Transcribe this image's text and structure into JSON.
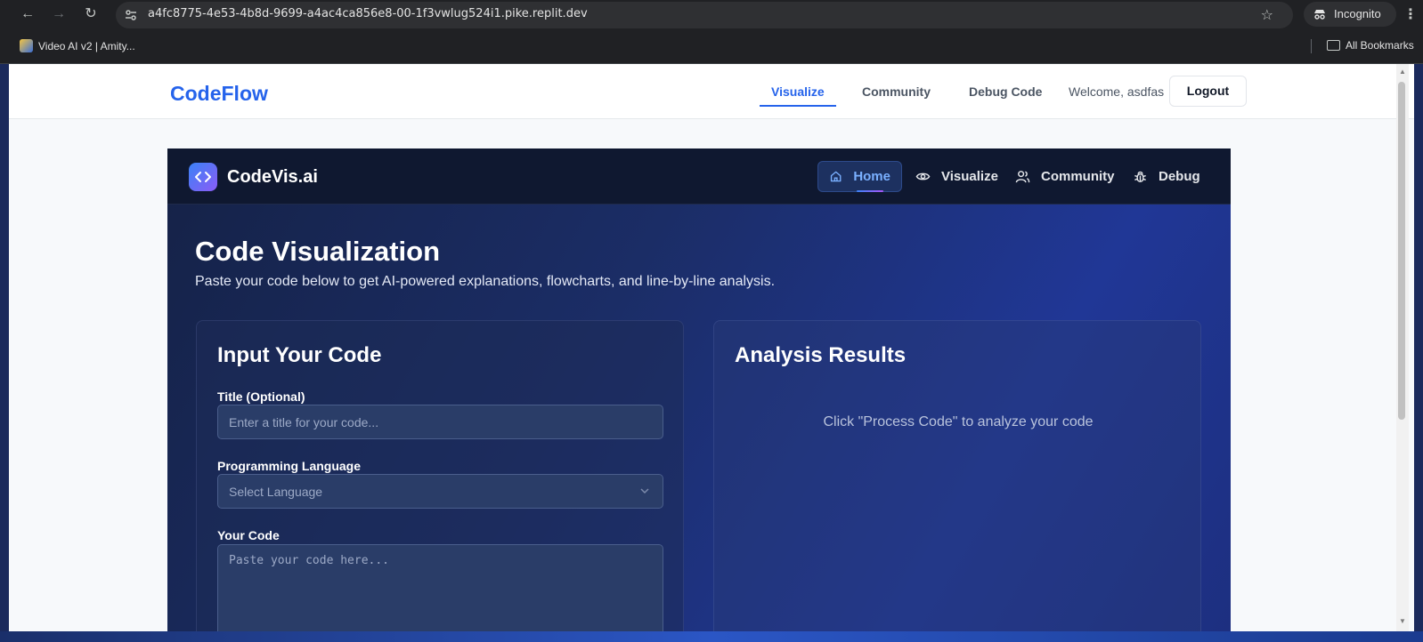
{
  "browser": {
    "url": "a4fc8775-4e53-4b8d-9699-a4ac4ca856e8-00-1f3vwlug524i1.pike.replit.dev",
    "incognito_label": "Incognito",
    "bookmark": "Video AI v2 | Amity...",
    "all_bookmarks": "All Bookmarks"
  },
  "site_header": {
    "logo": "CodeFlow",
    "nav": [
      "Visualize",
      "Community",
      "Debug Code"
    ],
    "active_nav": "Visualize",
    "welcome": "Welcome, asdfas",
    "logout": "Logout"
  },
  "app": {
    "brand": "CodeVis.ai",
    "nav": [
      {
        "label": "Home",
        "icon": "home-icon"
      },
      {
        "label": "Visualize",
        "icon": "eye-icon"
      },
      {
        "label": "Community",
        "icon": "users-icon"
      },
      {
        "label": "Debug",
        "icon": "bug-icon"
      }
    ],
    "title": "Code Visualization",
    "subtitle": "Paste your code below to get AI-powered explanations, flowcharts, and line-by-line analysis.",
    "input_card": {
      "title": "Input Your Code",
      "title_label": "Title (Optional)",
      "title_placeholder": "Enter a title for your code...",
      "language_label": "Programming Language",
      "language_placeholder": "Select Language",
      "code_label": "Your Code",
      "code_placeholder": "Paste your code here..."
    },
    "results_card": {
      "title": "Analysis Results",
      "placeholder": "Click \"Process Code\" to analyze your code"
    }
  },
  "colors": {
    "accent": "#2563eb",
    "app_nav_bg": "#0f1830",
    "home_active": "#7ab0ff"
  }
}
